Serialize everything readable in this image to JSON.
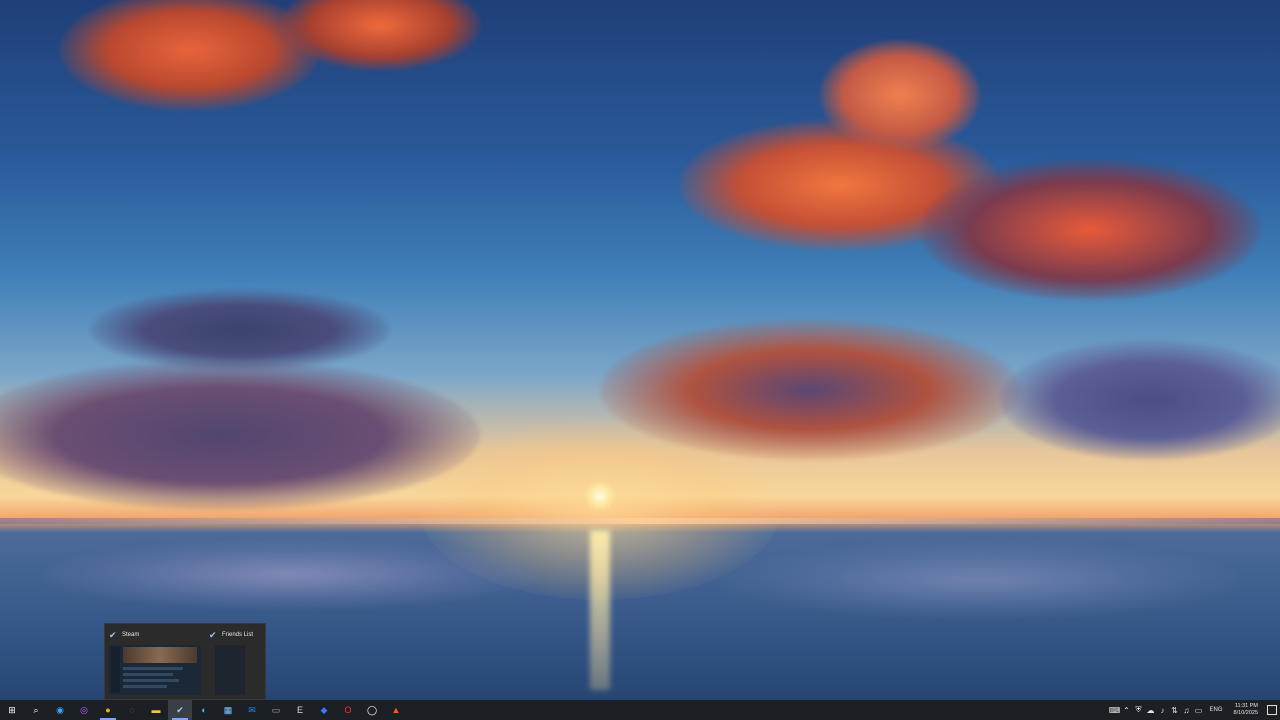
{
  "taskbar_preview": {
    "windows": [
      {
        "title": "Steam",
        "icon": "steam-icon"
      },
      {
        "title": "Friends List",
        "icon": "steam-icon"
      }
    ]
  },
  "taskbar": {
    "apps": [
      {
        "name": "start-button",
        "icon": "windows-icon",
        "glyph": "⊞",
        "color": "#ffffff"
      },
      {
        "name": "search-button",
        "icon": "search-icon",
        "glyph": "⌕",
        "color": "#ffffff"
      },
      {
        "name": "copilot-button",
        "icon": "copilot-icon",
        "glyph": "◉",
        "color": "#3ba7ff"
      },
      {
        "name": "app-ring",
        "icon": "ring-icon",
        "glyph": "◎",
        "color": "#b46bff"
      },
      {
        "name": "chrome-button",
        "icon": "chrome-icon",
        "glyph": "●",
        "color": "#f2b500"
      },
      {
        "name": "app-circle",
        "icon": "circle-icon",
        "glyph": "◌",
        "color": "#e04f4f"
      },
      {
        "name": "file-explorer-button",
        "icon": "folder-icon",
        "glyph": "▬",
        "color": "#f4c542"
      },
      {
        "name": "steam-button",
        "icon": "steam-icon",
        "glyph": "✔",
        "color": "#9fc7ff"
      },
      {
        "name": "edge-button",
        "icon": "edge-icon",
        "glyph": "◐",
        "color": "#2fc2ff"
      },
      {
        "name": "store-button",
        "icon": "store-icon",
        "glyph": "▦",
        "color": "#7ec8ff"
      },
      {
        "name": "outlook-button",
        "icon": "outlook-icon",
        "glyph": "✉",
        "color": "#1b8cff"
      },
      {
        "name": "app-box",
        "icon": "box-icon",
        "glyph": "▭",
        "color": "#9aa0a6"
      },
      {
        "name": "epic-button",
        "icon": "epic-games-icon",
        "glyph": "E",
        "color": "#dddddd"
      },
      {
        "name": "app-blue",
        "icon": "blue-app-icon",
        "glyph": "◆",
        "color": "#2f7bff"
      },
      {
        "name": "opera-button",
        "icon": "opera-icon",
        "glyph": "O",
        "color": "#ff2a3a"
      },
      {
        "name": "app-loop",
        "icon": "loop-icon",
        "glyph": "◯",
        "color": "#ffffff"
      },
      {
        "name": "brave-button",
        "icon": "brave-icon",
        "glyph": "▲",
        "color": "#ff5a1f"
      }
    ],
    "tray": {
      "icons": [
        "keyboard-icon",
        "chevron-up-icon",
        "shield-icon",
        "cloud-icon",
        "mic-icon",
        "network-icon",
        "volume-icon",
        "battery-icon"
      ],
      "language": "ENG",
      "time": "11:31 PM",
      "date": "8/10/2025"
    }
  }
}
